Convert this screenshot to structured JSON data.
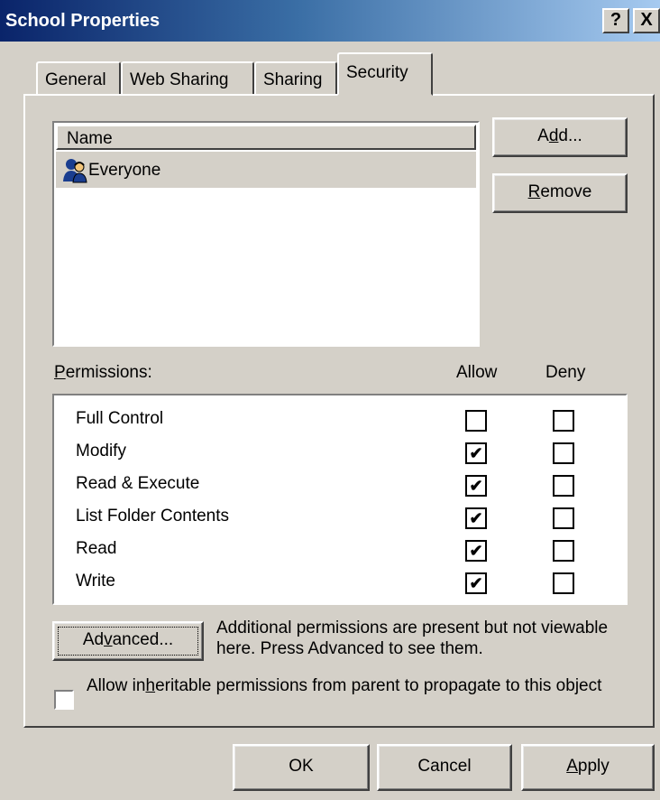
{
  "window": {
    "title": "School Properties",
    "help_glyph": "?",
    "close_glyph": "X"
  },
  "tabs": [
    {
      "label": "General",
      "active": false
    },
    {
      "label": "Web Sharing",
      "active": false
    },
    {
      "label": "Sharing",
      "active": false
    },
    {
      "label": "Security",
      "active": true
    }
  ],
  "names": {
    "column_header": "Name",
    "entries": [
      {
        "label": "Everyone",
        "icon": "group-users-icon",
        "selected": true
      }
    ]
  },
  "buttons": {
    "add": {
      "pre": "A",
      "mn": "d",
      "post": "d..."
    },
    "remove": {
      "pre": "",
      "mn": "R",
      "post": "emove"
    },
    "advanced": {
      "pre": "Ad",
      "mn": "v",
      "post": "anced..."
    },
    "ok": "OK",
    "cancel": "Cancel",
    "apply": {
      "pre": "",
      "mn": "A",
      "post": "pply"
    }
  },
  "permissions": {
    "label_mn": "P",
    "label_rest": "ermissions:",
    "allow_header": "Allow",
    "deny_header": "Deny",
    "rows": [
      {
        "label": "Full Control",
        "allow": false,
        "deny": false
      },
      {
        "label": "Modify",
        "allow": true,
        "deny": false
      },
      {
        "label": "Read & Execute",
        "allow": true,
        "deny": false
      },
      {
        "label": "List Folder Contents",
        "allow": true,
        "deny": false
      },
      {
        "label": "Read",
        "allow": true,
        "deny": false
      },
      {
        "label": "Write",
        "allow": true,
        "deny": false
      }
    ]
  },
  "advanced_note": "Additional permissions are present but not viewable here. Press Advanced to see them.",
  "inherit": {
    "checked": false,
    "pre": "Allow in",
    "mn": "h",
    "post": "eritable permissions from parent to propagate to this object"
  },
  "colors": {
    "dialog_bg": "#d4d0c8",
    "title_start": "#0a246a",
    "title_end": "#a6caf0"
  }
}
